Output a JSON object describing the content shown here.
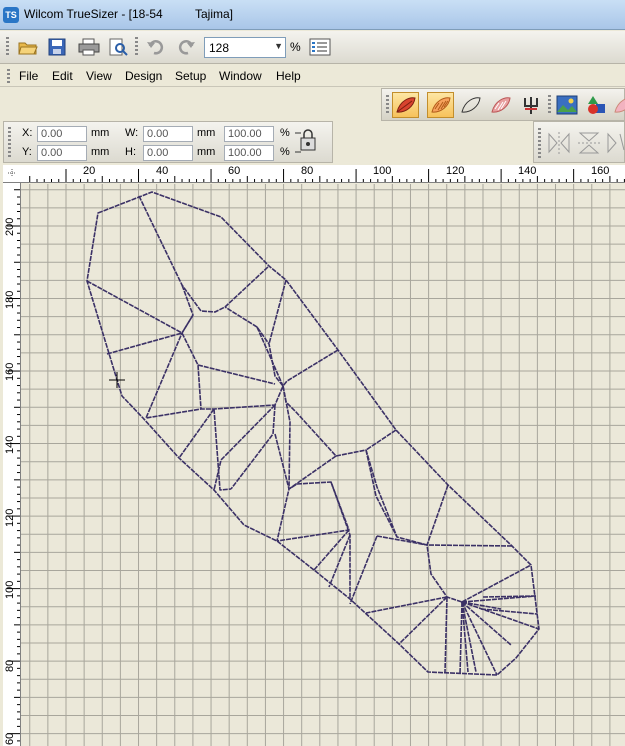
{
  "window": {
    "app_icon": "TS",
    "title_main": "Wilcom TrueSizer - [18-54",
    "title_machine": "Tajima]"
  },
  "toolbar": {
    "zoom_value": "128",
    "zoom_unit": "%",
    "icons": [
      "open-icon",
      "save-icon",
      "print-icon",
      "print-preview-icon",
      "undo-icon",
      "redo-icon",
      "zoom-dropdown-arrow",
      "object-properties-icon"
    ]
  },
  "menu": {
    "items": [
      "File",
      "Edit",
      "View",
      "Design",
      "Setup",
      "Window",
      "Help"
    ]
  },
  "tool_strip": {
    "icons": [
      "leaf-filled-icon",
      "leaf-stitch-icon",
      "leaf-outline-icon",
      "leaf-pattern-icon",
      "trident-icon",
      "picture-icon",
      "shapes-icon",
      "leaf-pink-icon"
    ]
  },
  "properties": {
    "x_label": "X:",
    "x_value": "0.00",
    "x_unit": "mm",
    "y_label": "Y:",
    "y_value": "0.00",
    "y_unit": "mm",
    "w_label": "W:",
    "w_value": "0.00",
    "w_unit": "mm",
    "h_label": "H:",
    "h_value": "0.00",
    "h_unit": "mm",
    "w_scale": "100.00",
    "w_scale_unit": "%",
    "h_scale": "100.00",
    "h_scale_unit": "%"
  },
  "rulers": {
    "horizontal": [
      "20",
      "40",
      "60",
      "80",
      "100",
      "120",
      "140",
      "160"
    ],
    "vertical": [
      "200",
      "180",
      "160",
      "140",
      "120",
      "100",
      "80",
      "60"
    ]
  },
  "colors": {
    "stitch": "#3b3166",
    "grid_major": "#a8a69c",
    "grid_minor": "#d6d3c5",
    "canvas": "#ebe8d9"
  }
}
